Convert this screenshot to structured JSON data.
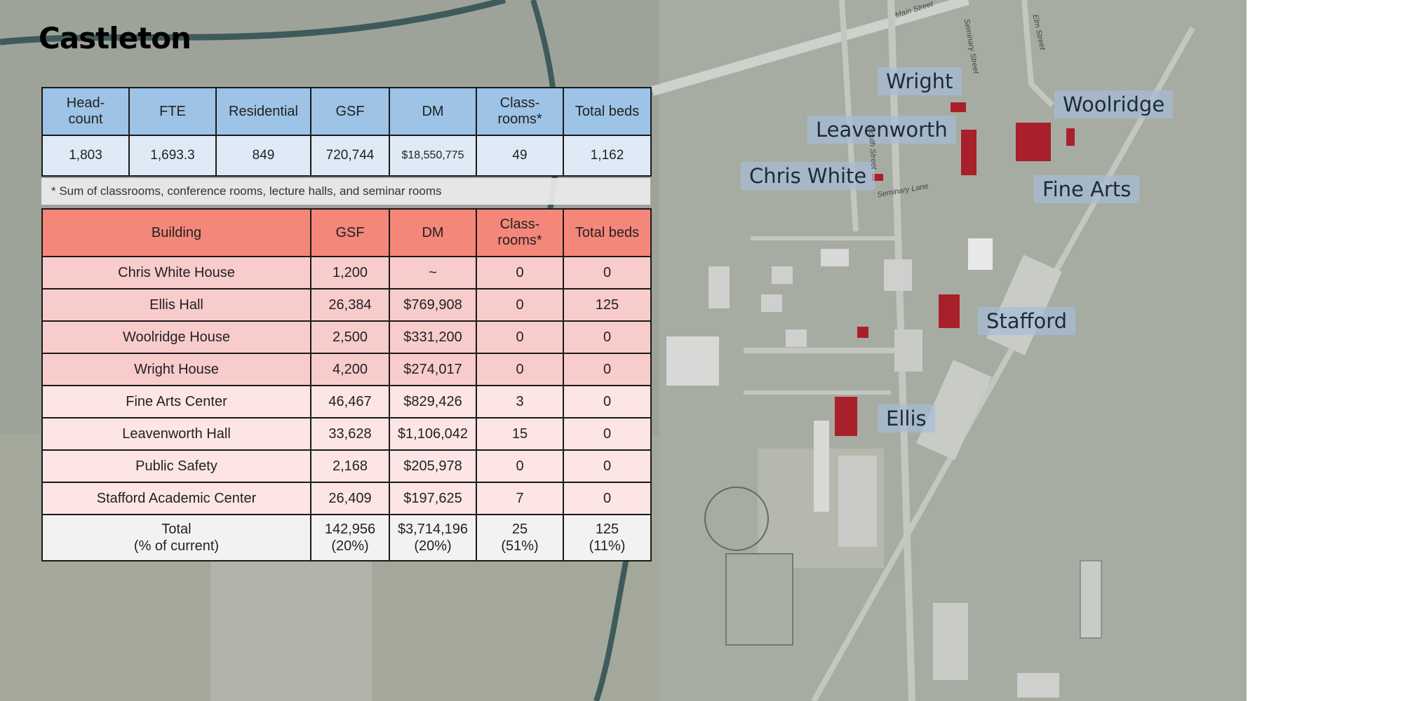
{
  "title": "Castleton",
  "summary": {
    "headers": [
      "Head-\ncount",
      "FTE",
      "Residential",
      "GSF",
      "DM",
      "Class-\nrooms*",
      "Total beds"
    ],
    "values": [
      "1,803",
      "1,693.3",
      "849",
      "720,744",
      "$18,550,775",
      "49",
      "1,162"
    ]
  },
  "footnote": "* Sum of classrooms, conference rooms, lecture halls, and seminar rooms",
  "buildings": {
    "headers": [
      "Building",
      "GSF",
      "DM",
      "Class-\nrooms*",
      "Total beds"
    ],
    "rows": [
      {
        "building": "Chris White House",
        "gsf": "1,200",
        "dm": "~",
        "classrooms": "0",
        "beds": "0"
      },
      {
        "building": "Ellis Hall",
        "gsf": "26,384",
        "dm": "$769,908",
        "classrooms": "0",
        "beds": "125"
      },
      {
        "building": "Woolridge House",
        "gsf": "2,500",
        "dm": "$331,200",
        "classrooms": "0",
        "beds": "0"
      },
      {
        "building": "Wright House",
        "gsf": "4,200",
        "dm": "$274,017",
        "classrooms": "0",
        "beds": "0"
      },
      {
        "building": "Fine Arts Center",
        "gsf": "46,467",
        "dm": "$829,426",
        "classrooms": "3",
        "beds": "0"
      },
      {
        "building": "Leavenworth Hall",
        "gsf": "33,628",
        "dm": "$1,106,042",
        "classrooms": "15",
        "beds": "0"
      },
      {
        "building": "Public Safety",
        "gsf": "2,168",
        "dm": "$205,978",
        "classrooms": "0",
        "beds": "0"
      },
      {
        "building": "Stafford Academic Center",
        "gsf": "26,409",
        "dm": "$197,625",
        "classrooms": "7",
        "beds": "0"
      }
    ],
    "total": {
      "building": "Total\n(% of current)",
      "gsf": "142,956\n(20%)",
      "dm": "$3,714,196\n(20%)",
      "classrooms": "25\n(51%)",
      "beds": "125\n(11%)"
    }
  },
  "map_labels": {
    "wright": "Wright",
    "woolridge": "Woolridge",
    "leavenworth": "Leavenworth",
    "chris_white": "Chris White",
    "fine_arts": "Fine Arts",
    "stafford": "Stafford",
    "ellis": "Ellis"
  },
  "streets": {
    "main": "Main Street",
    "seminary": "Seminary Lane",
    "seminary_st": "Seminary Street",
    "south": "South Street",
    "elm": "Elm Street"
  },
  "colors": {
    "highlight_building": "#a8202a",
    "summary_header": "#9dc3e6",
    "building_header": "#f4877a"
  }
}
